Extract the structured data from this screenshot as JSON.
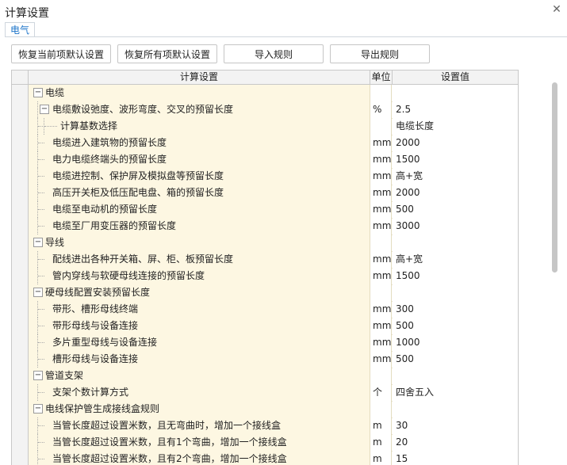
{
  "window": {
    "title": "计算设置"
  },
  "tabs": [
    {
      "label": "电气"
    }
  ],
  "toolbar": {
    "restore_current_label": "恢复当前项默认设置",
    "restore_all_label": "恢复所有项默认设置",
    "import_label": "导入规则",
    "export_label": "导出规则"
  },
  "table": {
    "columns": {
      "name": "计算设置",
      "unit": "单位",
      "value": "设置值"
    },
    "rows": [
      {
        "level": 0,
        "toggle": "−",
        "name": "电缆",
        "unit": "",
        "value": ""
      },
      {
        "level": 1,
        "toggle": "−",
        "name": "电缆敷设弛度、波形弯度、交叉的预留长度",
        "unit": "%",
        "value": "2.5"
      },
      {
        "level": 2,
        "toggle": "",
        "name": "计算基数选择",
        "unit": "",
        "value": "电缆长度"
      },
      {
        "level": 1,
        "toggle": "",
        "name": "电缆进入建筑物的预留长度",
        "unit": "mm",
        "value": "2000"
      },
      {
        "level": 1,
        "toggle": "",
        "name": "电力电缆终端头的预留长度",
        "unit": "mm",
        "value": "1500"
      },
      {
        "level": 1,
        "toggle": "",
        "name": "电缆进控制、保护屏及模拟盘等预留长度",
        "unit": "mm",
        "value": "高+宽"
      },
      {
        "level": 1,
        "toggle": "",
        "name": "高压开关柜及低压配电盘、箱的预留长度",
        "unit": "mm",
        "value": "2000"
      },
      {
        "level": 1,
        "toggle": "",
        "name": "电缆至电动机的预留长度",
        "unit": "mm",
        "value": "500"
      },
      {
        "level": 1,
        "toggle": "",
        "name": "电缆至厂用变压器的预留长度",
        "unit": "mm",
        "value": "3000"
      },
      {
        "level": 0,
        "toggle": "−",
        "name": "导线",
        "unit": "",
        "value": ""
      },
      {
        "level": 1,
        "toggle": "",
        "name": "配线进出各种开关箱、屏、柜、板预留长度",
        "unit": "mm",
        "value": "高+宽"
      },
      {
        "level": 1,
        "toggle": "",
        "name": "管内穿线与软硬母线连接的预留长度",
        "unit": "mm",
        "value": "1500"
      },
      {
        "level": 0,
        "toggle": "−",
        "name": "硬母线配置安装预留长度",
        "unit": "",
        "value": ""
      },
      {
        "level": 1,
        "toggle": "",
        "name": "带形、槽形母线终端",
        "unit": "mm",
        "value": "300"
      },
      {
        "level": 1,
        "toggle": "",
        "name": "带形母线与设备连接",
        "unit": "mm",
        "value": "500"
      },
      {
        "level": 1,
        "toggle": "",
        "name": "多片重型母线与设备连接",
        "unit": "mm",
        "value": "1000"
      },
      {
        "level": 1,
        "toggle": "",
        "name": "槽形母线与设备连接",
        "unit": "mm",
        "value": "500"
      },
      {
        "level": 0,
        "toggle": "−",
        "name": "管道支架",
        "unit": "",
        "value": ""
      },
      {
        "level": 1,
        "toggle": "",
        "name": "支架个数计算方式",
        "unit": "个",
        "value": "四舍五入"
      },
      {
        "level": 0,
        "toggle": "−",
        "name": "电线保护管生成接线盒规则",
        "unit": "",
        "value": ""
      },
      {
        "level": 1,
        "toggle": "",
        "name": "当管长度超过设置米数，且无弯曲时，增加一个接线盒",
        "unit": "m",
        "value": "30"
      },
      {
        "level": 1,
        "toggle": "",
        "name": "当管长度超过设置米数，且有1个弯曲，增加一个接线盒",
        "unit": "m",
        "value": "20"
      },
      {
        "level": 1,
        "toggle": "",
        "name": "当管长度超过设置米数，且有2个弯曲，增加一个接线盒",
        "unit": "m",
        "value": "15"
      }
    ]
  },
  "icons": {
    "close": "close-icon",
    "collapse": "minus-toggle-icon"
  }
}
